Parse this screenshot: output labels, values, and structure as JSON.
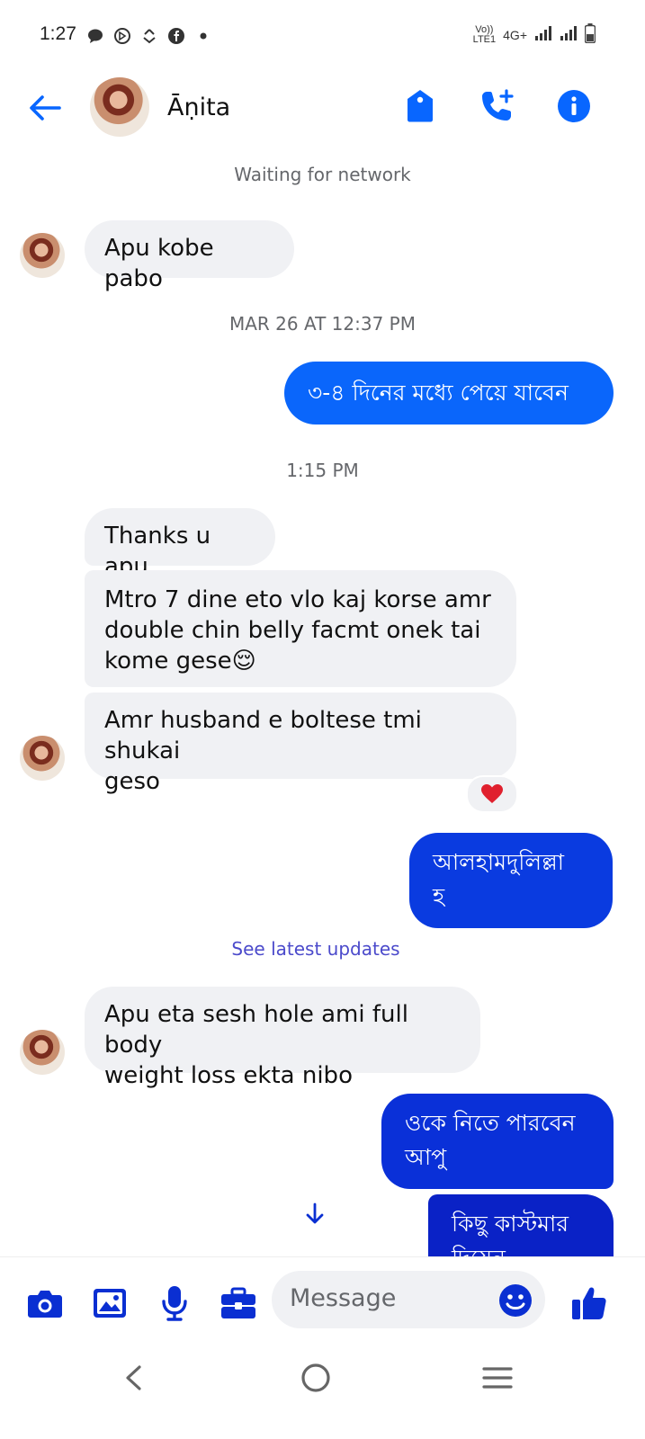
{
  "status_bar": {
    "time": "1:27",
    "network": "4G+",
    "left_icons": [
      "chat-bubble-icon",
      "whatsapp-icon",
      "sync-icon",
      "facebook-icon",
      "dot-icon"
    ],
    "right_icons": [
      "volte-icon",
      "signal-icon",
      "signal-icon",
      "battery-icon"
    ]
  },
  "header": {
    "contact_name": "Āṇita",
    "accent_color": "#0866ff"
  },
  "network_status": "Waiting for network",
  "messages": {
    "m1": "Apu kobe pabo",
    "ts1": "MAR 26 AT 12:37 PM",
    "m2": "৩-৪ দিনের মধ্যে পেয়ে যাবেন",
    "ts2": "1:15 PM",
    "m3": "Thanks u apu",
    "m4_line1": "Mtro 7 dine eto vlo kaj korse amr",
    "m4_line2": "double chin belly facmt onek tai",
    "m4_line3": "kome gese😌",
    "m5_line1": "Amr husband e boltese tmi shukai",
    "m5_line2": "geso",
    "reaction": "❤️",
    "m6_line1": "আলহামদুলিল্লা",
    "m6_line2": "হ",
    "see_latest": "See latest updates",
    "m7_line1": "Apu eta sesh hole ami full body",
    "m7_line2": "weight loss ekta nibo",
    "m8_line1": "ওকে নিতে পারবেন",
    "m8_line2": "আপু",
    "m9_line1": "কিছু কাস্টমার",
    "m9_line2": "দিয়েন"
  },
  "composer": {
    "placeholder": "Message",
    "icons": [
      "camera-icon",
      "gallery-icon",
      "mic-icon",
      "toolbox-icon",
      "emoji-icon",
      "like-icon"
    ]
  },
  "colors": {
    "outgoing_blue": "#0a5ef5",
    "outgoing_deep": "#0a2fd2",
    "incoming_bg": "#f0f1f4"
  }
}
